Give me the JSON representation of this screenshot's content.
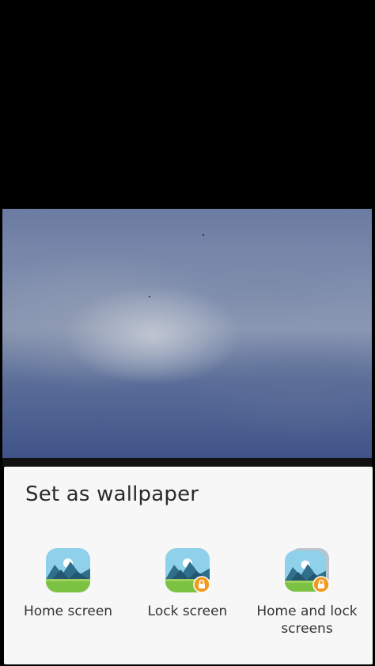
{
  "sheet": {
    "title": "Set as wallpaper",
    "options": [
      {
        "label": "Home screen",
        "icon": "landscape-icon"
      },
      {
        "label": "Lock screen",
        "icon": "landscape-lock-icon"
      },
      {
        "label": "Home and lock screens",
        "icon": "landscape-stack-lock-icon"
      }
    ]
  },
  "colors": {
    "sheet_background": "#f7f7f7",
    "lock_badge": "#f29a1f"
  }
}
